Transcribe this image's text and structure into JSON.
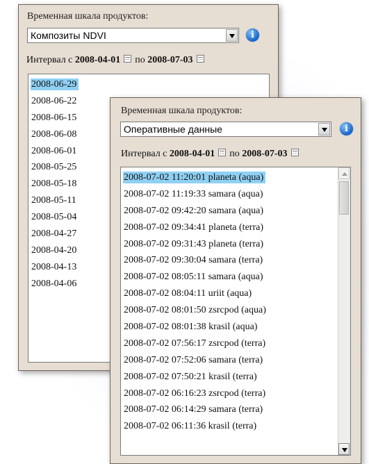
{
  "panel_back": {
    "timeline_label": "Временная шкала продуктов:",
    "product_select": "Композиты NDVI",
    "interval_prefix": "Интервал с",
    "interval_from": "2008-04-01",
    "interval_mid": "по",
    "interval_to": "2008-07-03",
    "dates": [
      "2008-06-29",
      "2008-06-22",
      "2008-06-15",
      "2008-06-08",
      "2008-06-01",
      "2008-05-25",
      "2008-05-18",
      "2008-05-11",
      "2008-05-04",
      "2008-04-27",
      "2008-04-20",
      "2008-04-13",
      "2008-04-06"
    ],
    "selected_index": 0
  },
  "panel_front": {
    "timeline_label": "Временная шкала продуктов:",
    "product_select": "Оперативные данные",
    "interval_prefix": "Интервал с",
    "interval_from": "2008-04-01",
    "interval_mid": "по",
    "interval_to": "2008-07-03",
    "items": [
      "2008-07-02 11:20:01 planeta (aqua)",
      "2008-07-02 11:19:33 samara (aqua)",
      "2008-07-02 09:42:20 samara (aqua)",
      "2008-07-02 09:34:41 planeta (terra)",
      "2008-07-02 09:31:43 planeta (terra)",
      "2008-07-02 09:30:04 samara (terra)",
      "2008-07-02 08:05:11 samara (aqua)",
      "2008-07-02 08:04:11 uriit (aqua)",
      "2008-07-02 08:01:50 zsrcpod (aqua)",
      "2008-07-02 08:01:38 krasil (aqua)",
      "2008-07-02 07:56:17 zsrcpod (terra)",
      "2008-07-02 07:52:06 samara (terra)",
      "2008-07-02 07:50:21 krasil (terra)",
      "2008-07-02 06:16:23 zsrcpod (terra)",
      "2008-07-02 06:14:29 samara (terra)",
      "2008-07-02 06:11:36 krasil (terra)"
    ],
    "selected_index": 0
  },
  "icons": {
    "info": "i",
    "info_name": "info-icon",
    "calendar_name": "calendar-icon"
  },
  "colors": {
    "panel_bg": "#e6ddd3",
    "selection": "#8fd0f3",
    "info_blue": "#1565c8"
  }
}
